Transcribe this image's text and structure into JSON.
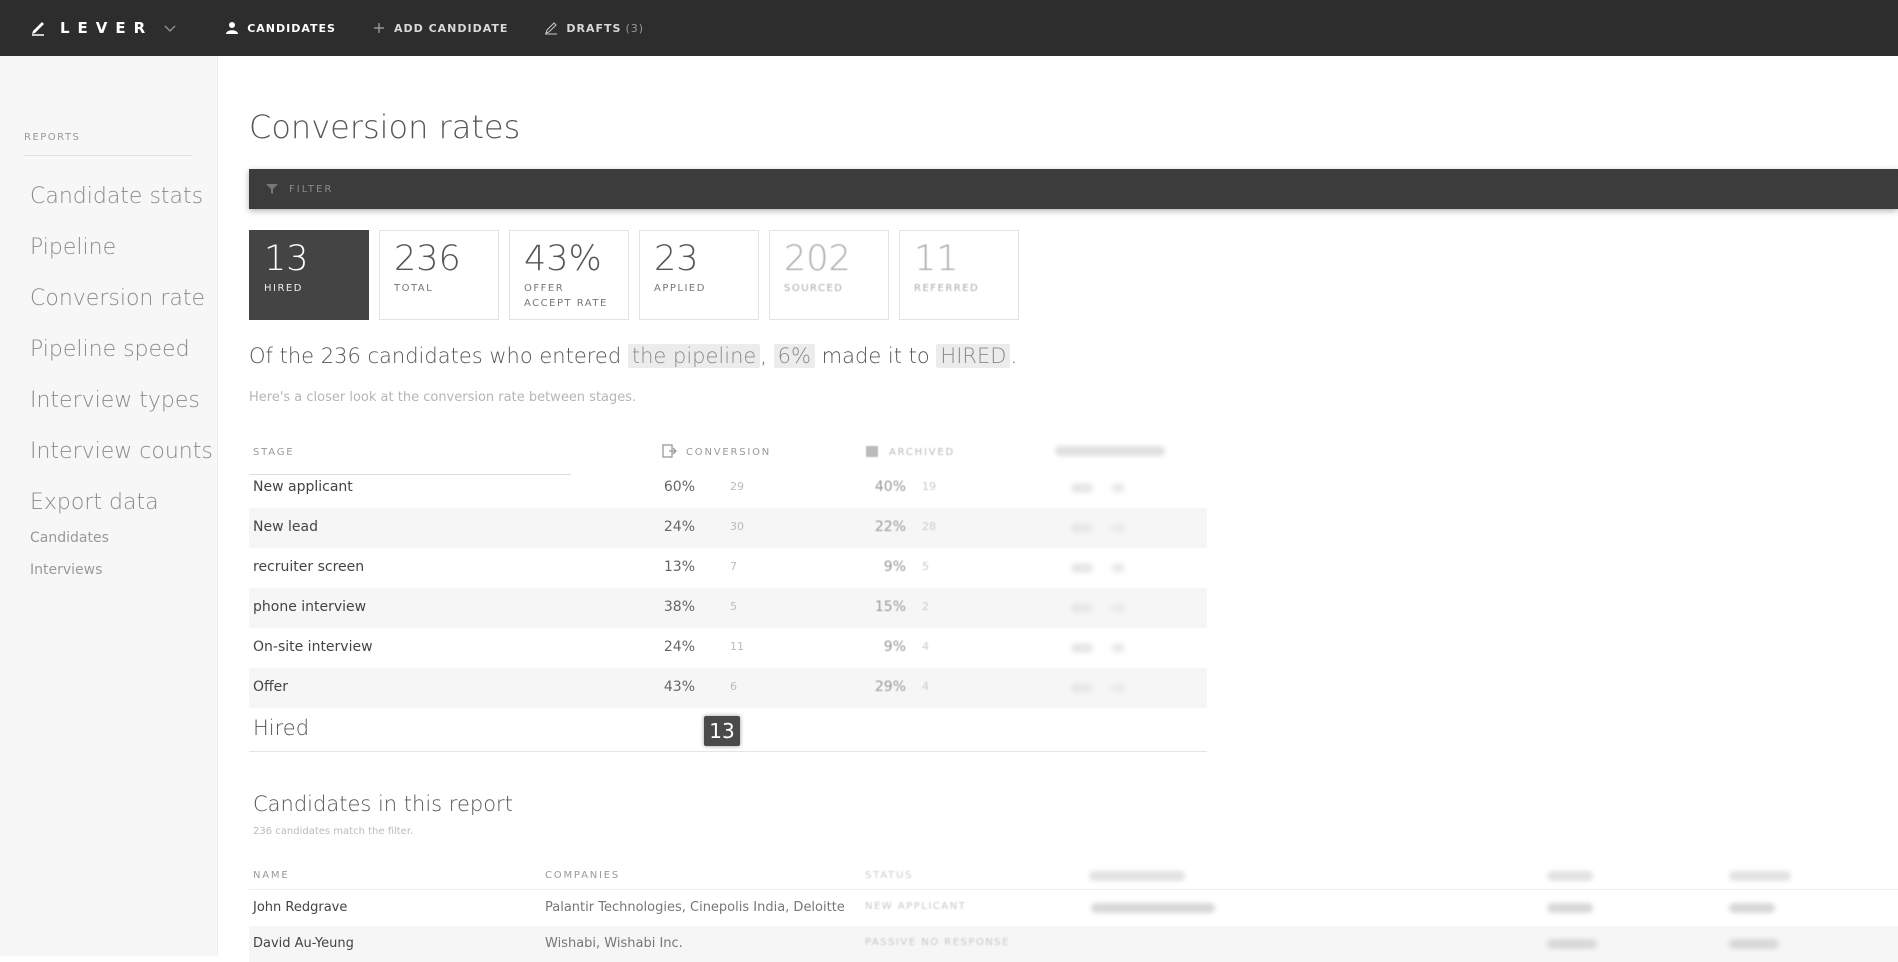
{
  "nav": {
    "brand": "LEVER",
    "links": [
      {
        "label": "CANDIDATES",
        "count": ""
      },
      {
        "label": "ADD CANDIDATE",
        "count": ""
      },
      {
        "label": "DRAFTS",
        "count": "(3)"
      }
    ]
  },
  "sidebar": {
    "heading": "REPORTS",
    "items": [
      "Candidate stats",
      "Pipeline",
      "Conversion rate",
      "Pipeline speed",
      "Interview types",
      "Interview counts",
      "Export data"
    ],
    "subitems": [
      "Candidates",
      "Interviews"
    ]
  },
  "page": {
    "title": "Conversion rates",
    "filter_label": "FILTER"
  },
  "stats": [
    {
      "num": "13",
      "label": "HIRED"
    },
    {
      "num": "236",
      "label": "TOTAL"
    },
    {
      "num": "43%",
      "label": "OFFER ACCEPT RATE"
    },
    {
      "num": "23",
      "label": "APPLIED"
    },
    {
      "num": "202",
      "label": "SOURCED"
    },
    {
      "num": "11",
      "label": "REFERRED"
    }
  ],
  "summary": {
    "prefix": "Of the 236 candidates who entered ",
    "chip1": "the pipeline",
    "mid": ", ",
    "chip2": "6%",
    "mid2": " made it to ",
    "chip3": "HIRED",
    "suffix": ".",
    "sub": "Here's a closer look at the conversion rate between stages."
  },
  "conversion": {
    "headers": {
      "stage": "STAGE",
      "conversion": "CONVERSION",
      "archived": "ARCHIVED"
    },
    "rows": [
      {
        "stage": "New applicant",
        "pct": "60%",
        "count": "29",
        "archived_pct": "40%",
        "archived_count": "19"
      },
      {
        "stage": "New lead",
        "pct": "24%",
        "count": "30",
        "archived_pct": "22%",
        "archived_count": "28"
      },
      {
        "stage": "recruiter screen",
        "pct": "13%",
        "count": "7",
        "archived_pct": "9%",
        "archived_count": "5"
      },
      {
        "stage": "phone interview",
        "pct": "38%",
        "count": "5",
        "archived_pct": "15%",
        "archived_count": "2"
      },
      {
        "stage": "On-site interview",
        "pct": "24%",
        "count": "11",
        "archived_pct": "9%",
        "archived_count": "4"
      },
      {
        "stage": "Offer",
        "pct": "43%",
        "count": "6",
        "archived_pct": "29%",
        "archived_count": "4"
      }
    ],
    "final": {
      "stage": "Hired",
      "count": "13"
    }
  },
  "candidates": {
    "title": "Candidates in this report",
    "sub": "236 candidates match the filter.",
    "headers": {
      "name": "NAME",
      "companies": "COMPANIES",
      "status": "STATUS"
    },
    "rows": [
      {
        "name": "John Redgrave",
        "companies": "Palantir Technologies, Cinepolis India, Deloitte ...",
        "status": "NEW APPLICANT"
      },
      {
        "name": "David Au-Yeung",
        "companies": "Wishabi, Wishabi Inc.",
        "status": "PASSIVE NO RESPONSE"
      }
    ]
  }
}
